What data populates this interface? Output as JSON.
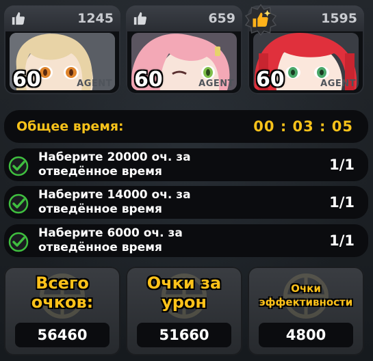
{
  "agents": [
    {
      "likes": "1245",
      "level": "60",
      "tag": "AGENT",
      "hair": "#e8d3a6",
      "bg": "#6b6f76",
      "eye": "#e0852c"
    },
    {
      "likes": "659",
      "level": "60",
      "tag": "AGENT",
      "hair": "#f3a8b6",
      "bg": "#5b5560",
      "eye": "#7fbf4a"
    },
    {
      "likes": "1595",
      "level": "60",
      "tag": "AGENT",
      "hair": "#e0303c",
      "bg": "#3a3d44",
      "eye": "#4aa86a"
    }
  ],
  "timer": {
    "label": "Общее время:",
    "value": "00 : 03 : 05"
  },
  "tasks": [
    {
      "text": "Наберите 20000 оч. за отведённое время",
      "progress": "1/1"
    },
    {
      "text": "Наберите 14000 оч. за отведённое время",
      "progress": "1/1"
    },
    {
      "text": "Наберите 6000 оч. за отведённое время",
      "progress": "1/1"
    }
  ],
  "stats": [
    {
      "label": "Всего очков:",
      "value": "56460"
    },
    {
      "label": "Очки за урон",
      "value": "51660"
    },
    {
      "label": "Очки эффективности",
      "value": "4800"
    }
  ],
  "colors": {
    "accent": "#f7c21a",
    "check": "#3fbf3f",
    "panel": "#0b0c0f"
  }
}
